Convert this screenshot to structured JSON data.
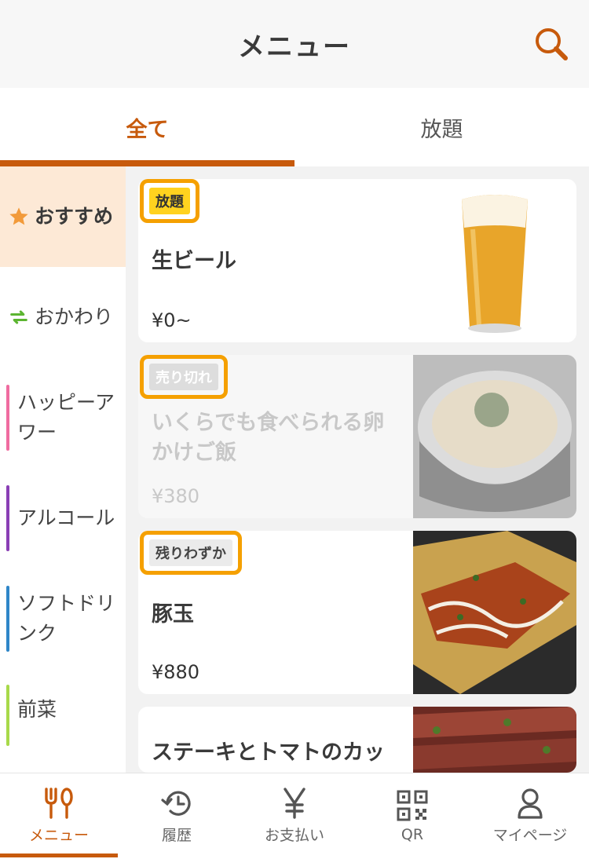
{
  "header": {
    "title": "メニュー"
  },
  "tabs": [
    {
      "label": "全て",
      "active": true
    },
    {
      "label": "放題",
      "active": false
    }
  ],
  "categories": [
    {
      "label": "おすすめ",
      "icon": "star-icon",
      "active": true
    },
    {
      "label": "おかわり",
      "icon": "refresh-icon",
      "color": "#5cb531"
    },
    {
      "label": "ハッピーアワー",
      "color": "#f06ca0"
    },
    {
      "label": "アルコール",
      "color": "#8a3fb5"
    },
    {
      "label": "ソフトドリンク",
      "color": "#2f86c8"
    },
    {
      "label": "前菜",
      "color": "#a8d94a"
    }
  ],
  "items": [
    {
      "badge": "放題",
      "name": "生ビール",
      "price": "¥0~",
      "image": "beer"
    },
    {
      "badge": "売り切れ",
      "name": "いくらでも食べられる卵かけご飯",
      "price": "¥380",
      "image": "rice",
      "sold_out": true
    },
    {
      "badge": "残りわずか",
      "name": "豚玉",
      "price": "¥880",
      "image": "okonomiyaki"
    },
    {
      "name": "ステーキとトマトのカッ",
      "image": "steak"
    }
  ],
  "bottom_nav": [
    {
      "label": "メニュー",
      "icon": "utensils-icon",
      "active": true
    },
    {
      "label": "履歴",
      "icon": "history-icon"
    },
    {
      "label": "お支払い",
      "icon": "yen-icon"
    },
    {
      "label": "QR",
      "icon": "qr-code-icon"
    },
    {
      "label": "マイページ",
      "icon": "person-icon"
    }
  ],
  "colors": {
    "accent": "#c75a0c",
    "highlight": "#f5a000",
    "badge_yellow": "#ffd21f"
  }
}
